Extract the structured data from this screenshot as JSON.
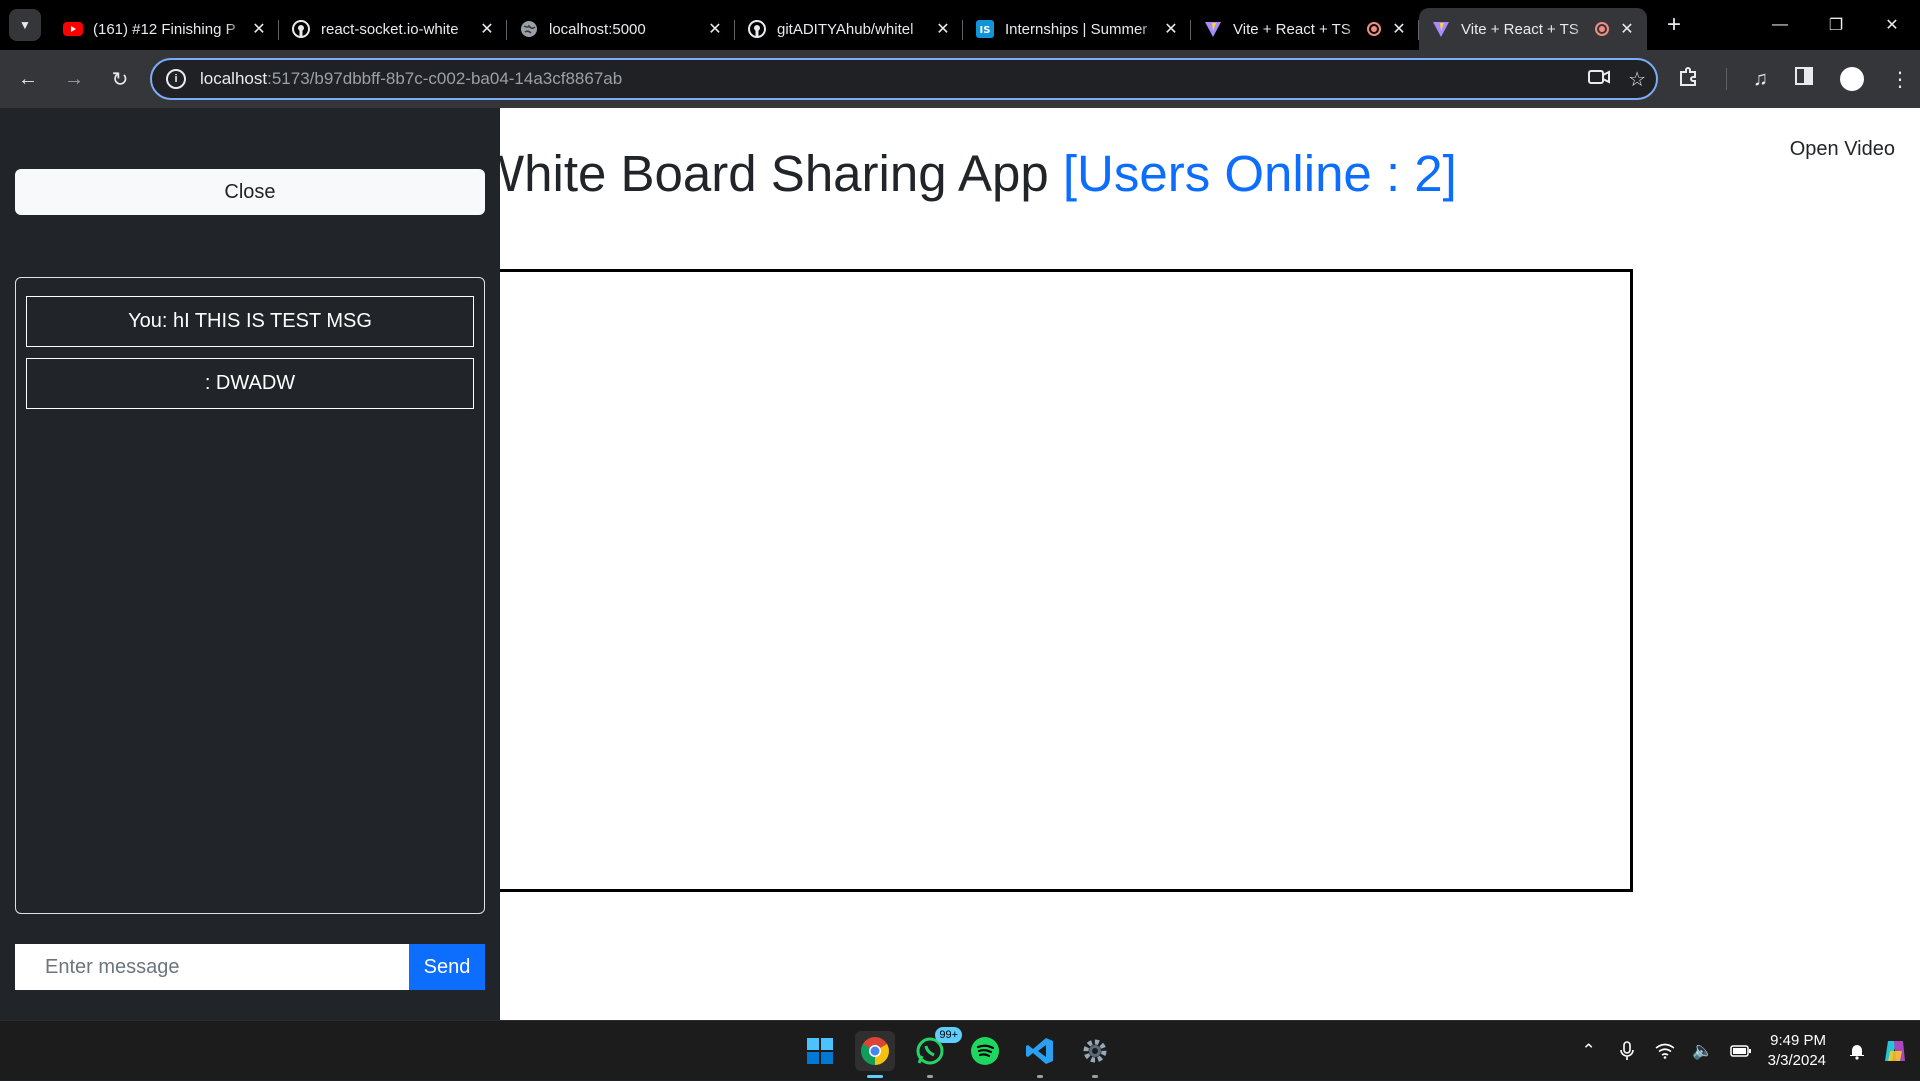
{
  "browser": {
    "tabs": [
      {
        "title": "(161) #12 Finishing P",
        "icon": "youtube-icon",
        "recording": false,
        "active": false
      },
      {
        "title": "react-socket.io-white",
        "icon": "github-icon",
        "recording": false,
        "active": false
      },
      {
        "title": "localhost:5000",
        "icon": "globe-icon",
        "recording": false,
        "active": false
      },
      {
        "title": "gitADITYAhub/whitel",
        "icon": "github-icon",
        "recording": false,
        "active": false
      },
      {
        "title": "Internships | Summer",
        "icon": "internshala-icon",
        "recording": false,
        "active": false
      },
      {
        "title": "Vite + React + TS",
        "icon": "vite-icon",
        "recording": true,
        "active": false
      },
      {
        "title": "Vite + React + TS",
        "icon": "vite-icon",
        "recording": true,
        "active": true
      }
    ],
    "url_host": "localhost",
    "url_rest": ":5173/b97dbbff-8b7c-c002-ba04-14a3cf8867ab"
  },
  "app": {
    "title_main": "hite Board Sharing App",
    "title_prefix": "W",
    "users_online": "[Users Online : 2]",
    "open_video": "Open Video",
    "close_label": "Close",
    "messages": [
      {
        "text": "You: hI THIS IS TEST MSG"
      },
      {
        "text": ": DWADW"
      }
    ],
    "input_placeholder": "Enter message",
    "send_label": "Send"
  },
  "taskbar": {
    "whatsapp_badge": "99+",
    "time": "9:49 PM",
    "date": "3/3/2024"
  },
  "colors": {
    "accent": "#0d6efd",
    "sidebar": "#212529"
  }
}
